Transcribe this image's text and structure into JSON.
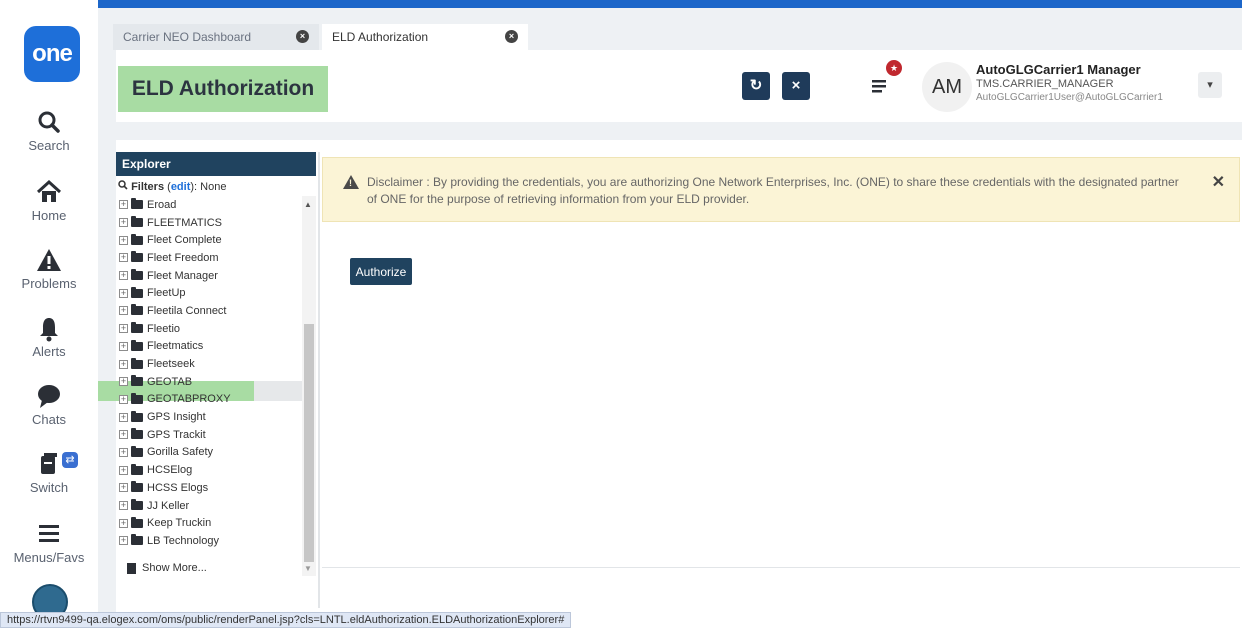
{
  "nav": {
    "logo": "one",
    "items": [
      {
        "label": "Search",
        "icon": "search-icon"
      },
      {
        "label": "Home",
        "icon": "home-icon"
      },
      {
        "label": "Problems",
        "icon": "warning-icon"
      },
      {
        "label": "Alerts",
        "icon": "bell-icon"
      },
      {
        "label": "Chats",
        "icon": "chat-icon"
      },
      {
        "label": "Switch",
        "icon": "switch-icon"
      },
      {
        "label": "Menus/Favs",
        "icon": "menu-icon"
      }
    ],
    "switch_badge": "⇄"
  },
  "tabs": [
    {
      "label": "Carrier NEO Dashboard",
      "active": false
    },
    {
      "label": "ELD Authorization",
      "active": true
    }
  ],
  "header": {
    "title": "ELD Authorization",
    "refresh_glyph": "↻",
    "close_glyph": "×"
  },
  "user": {
    "initials": "AM",
    "name": "AutoGLGCarrier1 Manager",
    "role": "TMS.CARRIER_MANAGER",
    "email": "AutoGLGCarrier1User@AutoGLGCarrier1"
  },
  "explorer": {
    "title": "Explorer",
    "filters_label": "Filters",
    "filters_edit": "edit",
    "filters_value": "None",
    "items": [
      "Eroad",
      "FLEETMATICS",
      "Fleet Complete",
      "Fleet Freedom",
      "Fleet Manager",
      "FleetUp",
      "Fleetila Connect",
      "Fleetio",
      "Fleetmatics",
      "Fleetseek",
      "GEOTAB",
      "GEOTABPROXY",
      "GPS Insight",
      "GPS Trackit",
      "Gorilla Safety",
      "HCSElog",
      "HCSS Elogs",
      "JJ Keller",
      "Keep Truckin",
      "LB Technology"
    ],
    "selected_item": "GEOTAB",
    "show_more": "Show More..."
  },
  "disclaimer": {
    "text": "Disclaimer : By providing the credentials, you are authorizing One Network Enterprises, Inc. (ONE) to share these credentials with the designated partner of ONE for the purpose of retrieving information from your ELD provider."
  },
  "authorize_label": "Authorize",
  "status_url": "https://rtvn9499-qa.elogex.com/oms/public/renderPanel.jsp?cls=LNTL.eldAuthorization.ELDAuthorizationExplorer#",
  "colors": {
    "brand_blue": "#1e6fd9",
    "dark_navy": "#20435f",
    "green_highlight": "#a8dca3",
    "disclaimer_bg": "#fbf4d6",
    "badge_red": "#c0282e"
  }
}
